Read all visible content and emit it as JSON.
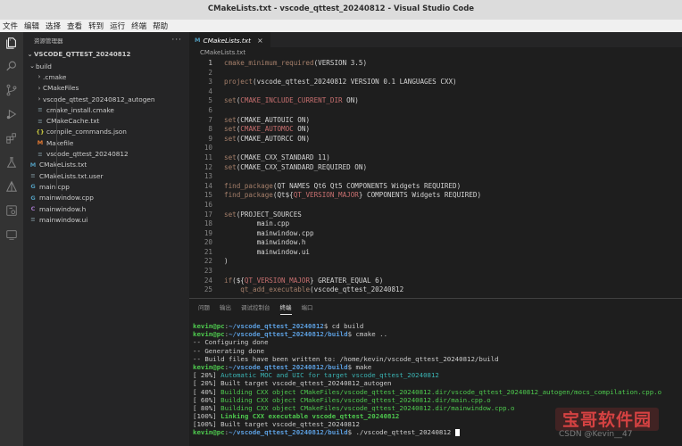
{
  "window": {
    "title": "CMakeLists.txt - vscode_qttest_20240812 - Visual Studio Code"
  },
  "menu": [
    "文件",
    "编辑",
    "选择",
    "查看",
    "转到",
    "运行",
    "终端",
    "帮助"
  ],
  "activity_icons": [
    "files-icon",
    "search-icon",
    "source-control-icon",
    "run-debug-icon",
    "extensions-icon",
    "testing-icon",
    "cmake-icon",
    "remote-icon",
    "terminal-icon"
  ],
  "sidebar": {
    "header": "资源管理器",
    "more": "···",
    "project": "VSCODE_QTTEST_20240812",
    "items": [
      {
        "label": "build",
        "chev": "⌄",
        "icon": "",
        "color": "#cccccc",
        "depth": 1
      },
      {
        "label": ".cmake",
        "chev": "›",
        "icon": "",
        "color": "#cccccc",
        "depth": 2
      },
      {
        "label": "CMakeFiles",
        "chev": "›",
        "icon": "",
        "color": "#cccccc",
        "depth": 2
      },
      {
        "label": "vscode_qttest_20240812_autogen",
        "chev": "›",
        "icon": "",
        "color": "#cccccc",
        "depth": 2
      },
      {
        "label": "cmake_install.cmake",
        "chev": "",
        "icon": "≡",
        "color": "#6d8086",
        "depth": 2
      },
      {
        "label": "CMakeCache.txt",
        "chev": "",
        "icon": "≡",
        "color": "#6d8086",
        "depth": 2
      },
      {
        "label": "compile_commands.json",
        "chev": "",
        "icon": "{}",
        "color": "#cbcb41",
        "depth": 2
      },
      {
        "label": "Makefile",
        "chev": "",
        "icon": "M",
        "color": "#e37933",
        "depth": 2
      },
      {
        "label": "vscode_qttest_20240812",
        "chev": "",
        "icon": "≡",
        "color": "#6d8086",
        "depth": 2
      },
      {
        "label": "CMakeLists.txt",
        "chev": "",
        "icon": "M",
        "color": "#519aba",
        "depth": 1
      },
      {
        "label": "CMakeLists.txt.user",
        "chev": "",
        "icon": "≡",
        "color": "#6d8086",
        "depth": 1
      },
      {
        "label": "main.cpp",
        "chev": "",
        "icon": "G",
        "color": "#519aba",
        "depth": 1
      },
      {
        "label": "mainwindow.cpp",
        "chev": "",
        "icon": "G",
        "color": "#519aba",
        "depth": 1
      },
      {
        "label": "mainwindow.h",
        "chev": "",
        "icon": "C",
        "color": "#a074c4",
        "depth": 1
      },
      {
        "label": "mainwindow.ui",
        "chev": "",
        "icon": "≡",
        "color": "#6d8086",
        "depth": 1
      }
    ]
  },
  "editor": {
    "tab": {
      "label": "CMakeLists.txt",
      "icon": "M",
      "close": "×"
    },
    "breadcrumb": "CMakeLists.txt",
    "lines": [
      {
        "n": "1",
        "t": "<span class=\"k\">cmake_minimum_required</span>(VERSION 3.5)"
      },
      {
        "n": "2",
        "t": ""
      },
      {
        "n": "3",
        "t": "<span class=\"k\">project</span>(vscode_qttest_20240812 VERSION 0.1 LANGUAGES CXX)"
      },
      {
        "n": "4",
        "t": ""
      },
      {
        "n": "5",
        "t": "<span class=\"k\">set</span>(<span class=\"v\">CMAKE_INCLUDE_CURRENT_DIR</span> ON)"
      },
      {
        "n": "6",
        "t": ""
      },
      {
        "n": "7",
        "t": "<span class=\"k\">set</span>(CMAKE_AUTOUIC ON)"
      },
      {
        "n": "8",
        "t": "<span class=\"k\">set</span>(<span class=\"v\">CMAKE_AUTOMOC</span> ON)"
      },
      {
        "n": "9",
        "t": "<span class=\"k\">set</span>(CMAKE_AUTORCC ON)"
      },
      {
        "n": "10",
        "t": ""
      },
      {
        "n": "11",
        "t": "<span class=\"k\">set</span>(CMAKE_CXX_STANDARD 11)"
      },
      {
        "n": "12",
        "t": "<span class=\"k\">set</span>(CMAKE_CXX_STANDARD_REQUIRED ON)"
      },
      {
        "n": "13",
        "t": ""
      },
      {
        "n": "14",
        "t": "<span class=\"k\">find_package</span>(QT NAMES Qt6 Qt5 COMPONENTS Widgets REQUIRED)"
      },
      {
        "n": "15",
        "t": "<span class=\"k\">find_package</span>(Qt${<span class=\"v\">QT_VERSION_MAJOR</span>} COMPONENTS Widgets REQUIRED)"
      },
      {
        "n": "16",
        "t": ""
      },
      {
        "n": "17",
        "t": "<span class=\"k\">set</span>(PROJECT_SOURCES"
      },
      {
        "n": "18",
        "t": "        main.cpp"
      },
      {
        "n": "19",
        "t": "        mainwindow.cpp"
      },
      {
        "n": "20",
        "t": "        mainwindow.h"
      },
      {
        "n": "21",
        "t": "        mainwindow.ui"
      },
      {
        "n": "22",
        "t": ")"
      },
      {
        "n": "23",
        "t": ""
      },
      {
        "n": "24",
        "t": "<span class=\"k\">if</span>(${<span class=\"v\">QT_VERSION_MAJOR</span>} GREATER_EQUAL 6)"
      },
      {
        "n": "25",
        "t": "    <span class=\"k\">qt_add_executable</span>(vscode_qttest_20240812"
      }
    ]
  },
  "panel": {
    "tabs": [
      {
        "label": "问题",
        "active": false
      },
      {
        "label": "输出",
        "active": false
      },
      {
        "label": "调试控制台",
        "active": false
      },
      {
        "label": "终端",
        "active": true
      },
      {
        "label": "端口",
        "active": false
      }
    ],
    "terminal": [
      {
        "prompt": "kevin@pc",
        "path": "~/vscode_qttest_20240812",
        "cmd": "$ cd build"
      },
      {
        "prompt": "kevin@pc",
        "path": "~/vscode_qttest_20240812/build",
        "cmd": "$ cmake .."
      },
      {
        "text": "-- Configuring done",
        "cls": ""
      },
      {
        "text": "-- Generating done",
        "cls": ""
      },
      {
        "text": "-- Build files have been written to: /home/kevin/vscode_qttest_20240812/build",
        "cls": ""
      },
      {
        "prompt": "kevin@pc",
        "path": "~/vscode_qttest_20240812/build",
        "cmd": "$ make"
      },
      {
        "pct": "[ 20%] ",
        "text": "Automatic MOC and UIC for target vscode_qttest_20240812",
        "cls": "cyan"
      },
      {
        "pct": "[ 20%] ",
        "text": "Built target vscode_qttest_20240812_autogen",
        "cls": ""
      },
      {
        "pct": "[ 40%] ",
        "text": "Building CXX object CMakeFiles/vscode_qttest_20240812.dir/vscode_qttest_20240812_autogen/mocs_compilation.cpp.o",
        "cls": "green"
      },
      {
        "pct": "[ 60%] ",
        "text": "Building CXX object CMakeFiles/vscode_qttest_20240812.dir/main.cpp.o",
        "cls": "green"
      },
      {
        "pct": "[ 80%] ",
        "text": "Building CXX object CMakeFiles/vscode_qttest_20240812.dir/mainwindow.cpp.o",
        "cls": "green"
      },
      {
        "pct": "[100%] ",
        "text": "Linking CXX executable vscode_qttest_20240812",
        "cls": "greenb"
      },
      {
        "pct": "[100%] ",
        "text": "Built target vscode_qttest_20240812",
        "cls": ""
      },
      {
        "prompt": "kevin@pc",
        "path": "~/vscode_qttest_20240812/build",
        "cmd": "$ ./vscode_qttest_20240812",
        "cursor": true
      }
    ]
  },
  "watermark": {
    "logo": "宝哥软件园",
    "credit": "CSDN @Kevin__47"
  }
}
